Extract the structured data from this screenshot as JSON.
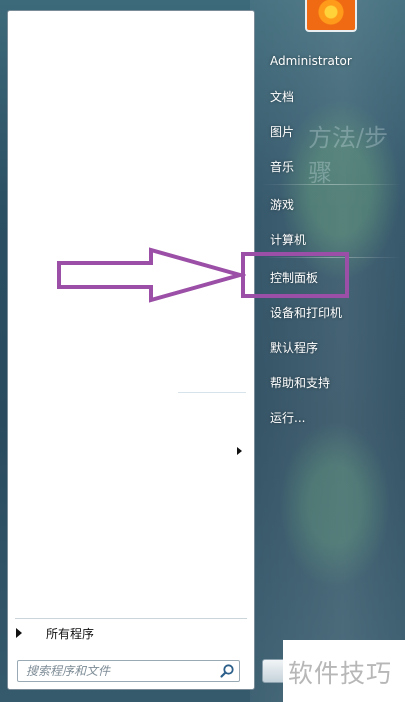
{
  "start_menu": {
    "user": {
      "name": "Administrator",
      "picture_icon": "flower-user-picture"
    },
    "right_items": [
      {
        "label": "文档",
        "name": "right-item-documents"
      },
      {
        "label": "图片",
        "name": "right-item-pictures"
      },
      {
        "label": "音乐",
        "name": "right-item-music"
      },
      {
        "label": "游戏",
        "name": "right-item-games"
      },
      {
        "label": "计算机",
        "name": "right-item-computer"
      },
      {
        "label": "控制面板",
        "name": "right-item-control-panel"
      },
      {
        "label": "设备和打印机",
        "name": "right-item-devices-printers"
      },
      {
        "label": "默认程序",
        "name": "right-item-default-programs"
      },
      {
        "label": "帮助和支持",
        "name": "right-item-help-support"
      },
      {
        "label": "运行...",
        "name": "right-item-run"
      }
    ],
    "all_programs_label": "所有程序",
    "search_placeholder": "搜索程序和文件",
    "search_icon": "search-icon",
    "shutdown_icon": "shutdown-button"
  },
  "background_text": {
    "heading": "方法/步骤"
  },
  "annotation": {
    "arrow_color": "#9b4fa6",
    "box_color": "#9b4fa6"
  },
  "watermark": "软件技巧"
}
